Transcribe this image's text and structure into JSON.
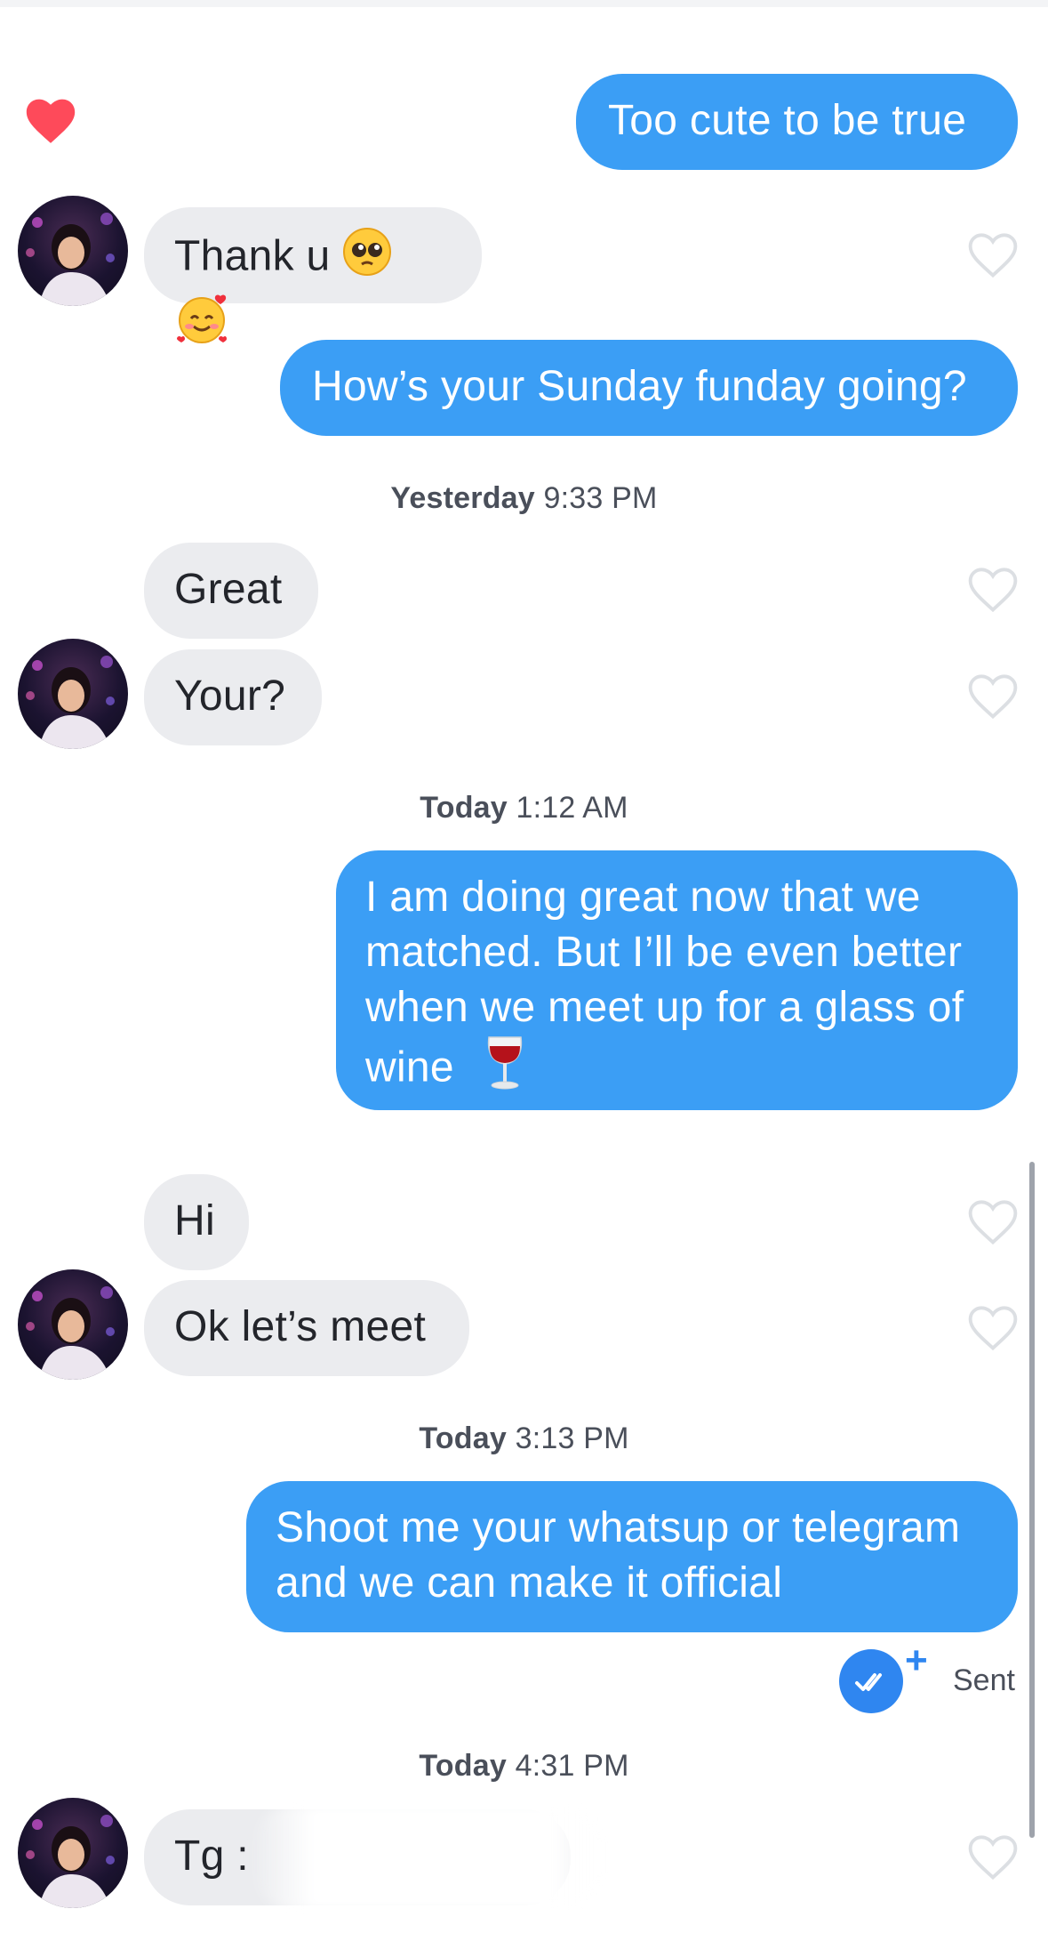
{
  "conversation": {
    "msg1": {
      "text": "Too cute to be true"
    },
    "msg2": {
      "text": "Thank u"
    },
    "msg3": {
      "text": "How’s your Sunday funday going?"
    },
    "stamp1": {
      "day": "Yesterday",
      "time": "9:33 PM"
    },
    "msg4": {
      "text": "Great"
    },
    "msg5": {
      "text": "Your?"
    },
    "stamp2": {
      "day": "Today",
      "time": "1:12 AM"
    },
    "msg6": {
      "lines": [
        "I am doing great now that we",
        "matched. But I’ll be even better",
        "when we meet up for a glass of",
        "wine"
      ]
    },
    "msg7": {
      "text": "Hi"
    },
    "msg8": {
      "text": "Ok let’s meet"
    },
    "stamp3": {
      "day": "Today",
      "time": "3:13 PM"
    },
    "msg9": {
      "lines": [
        "Shoot me your whatsup or telegram",
        "and we can make it official"
      ]
    },
    "status": {
      "label": "Sent",
      "plus": "+"
    },
    "stamp4": {
      "day": "Today",
      "time": "4:31 PM"
    },
    "msg10": {
      "text": "Tg :"
    }
  },
  "colors": {
    "sent_bubble": "#3b9ef5",
    "received_bubble": "#ebecef",
    "liked_heart": "#fe4a5a",
    "read_receipt": "#2f86f0"
  },
  "icons": [
    "heart-filled-icon",
    "heart-outline-icon",
    "pleading-face-emoji",
    "smiling-face-with-hearts-emoji",
    "wine-glass-emoji",
    "read-receipt-icon"
  ]
}
